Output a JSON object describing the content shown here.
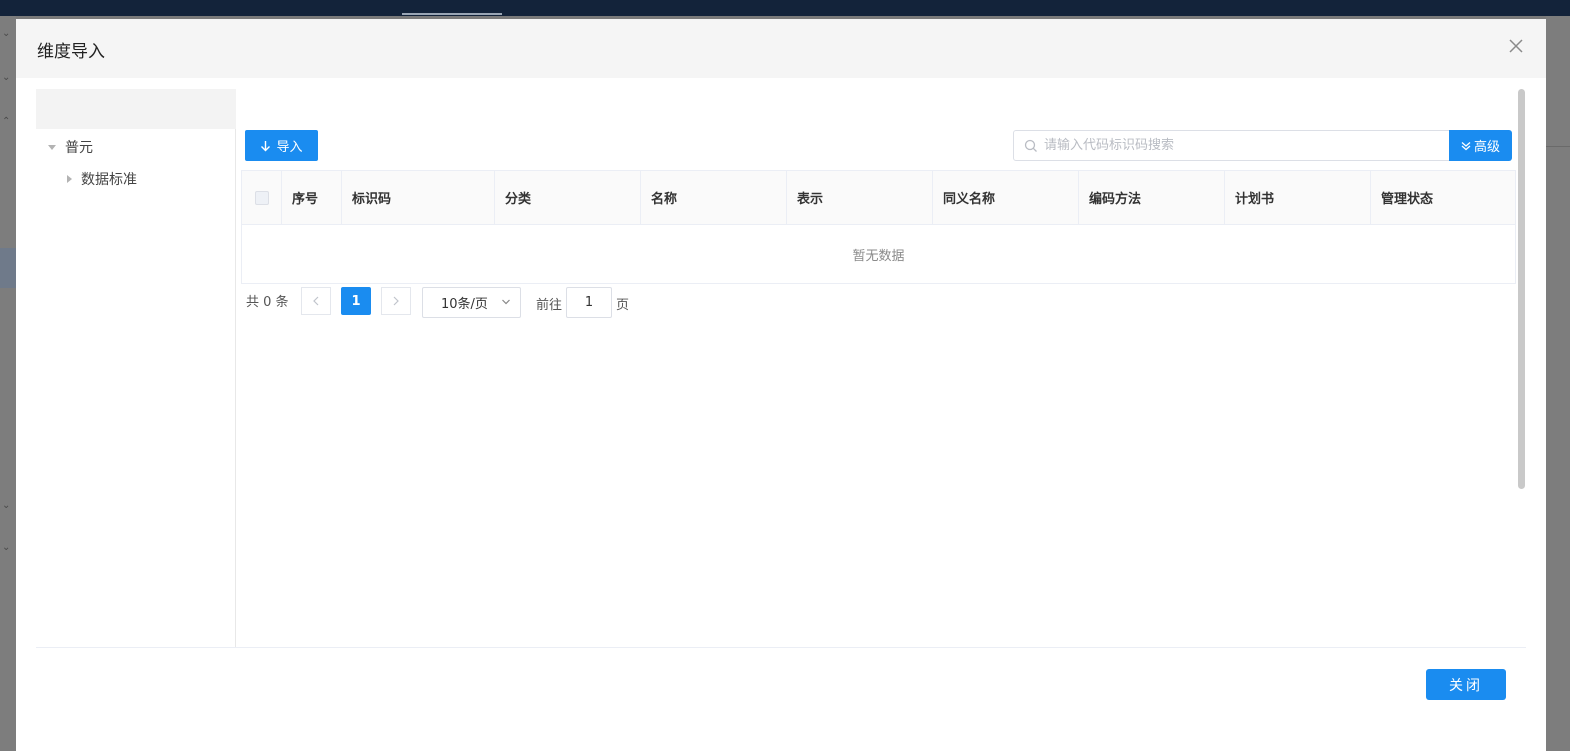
{
  "dialog": {
    "title": "维度导入",
    "close_icon": "close-icon"
  },
  "tree": {
    "nodes": [
      {
        "label": "普元",
        "expanded": true
      },
      {
        "label": "数据标准",
        "expanded": false
      }
    ]
  },
  "toolbar": {
    "import_label": "导入",
    "import_icon": "arrow-down-icon",
    "search_placeholder": "请输入代码标识码搜索",
    "search_value": "",
    "advanced_label": "高级",
    "advanced_icon": "double-chevron-down-icon"
  },
  "table": {
    "columns": [
      "序号",
      "标识码",
      "分类",
      "名称",
      "表示",
      "同义名称",
      "编码方法",
      "计划书",
      "管理状态"
    ],
    "rows": [],
    "empty_text": "暂无数据"
  },
  "pagination": {
    "total_text": "共 0 条",
    "current_page": "1",
    "page_size": "10条/页",
    "goto_label": "前往",
    "goto_value": "1",
    "page_unit": "页"
  },
  "footer": {
    "close_label": "关闭"
  },
  "colors": {
    "primary": "#1a8cf0",
    "header_bg": "#f5f5f5",
    "border": "#ebeef5"
  }
}
